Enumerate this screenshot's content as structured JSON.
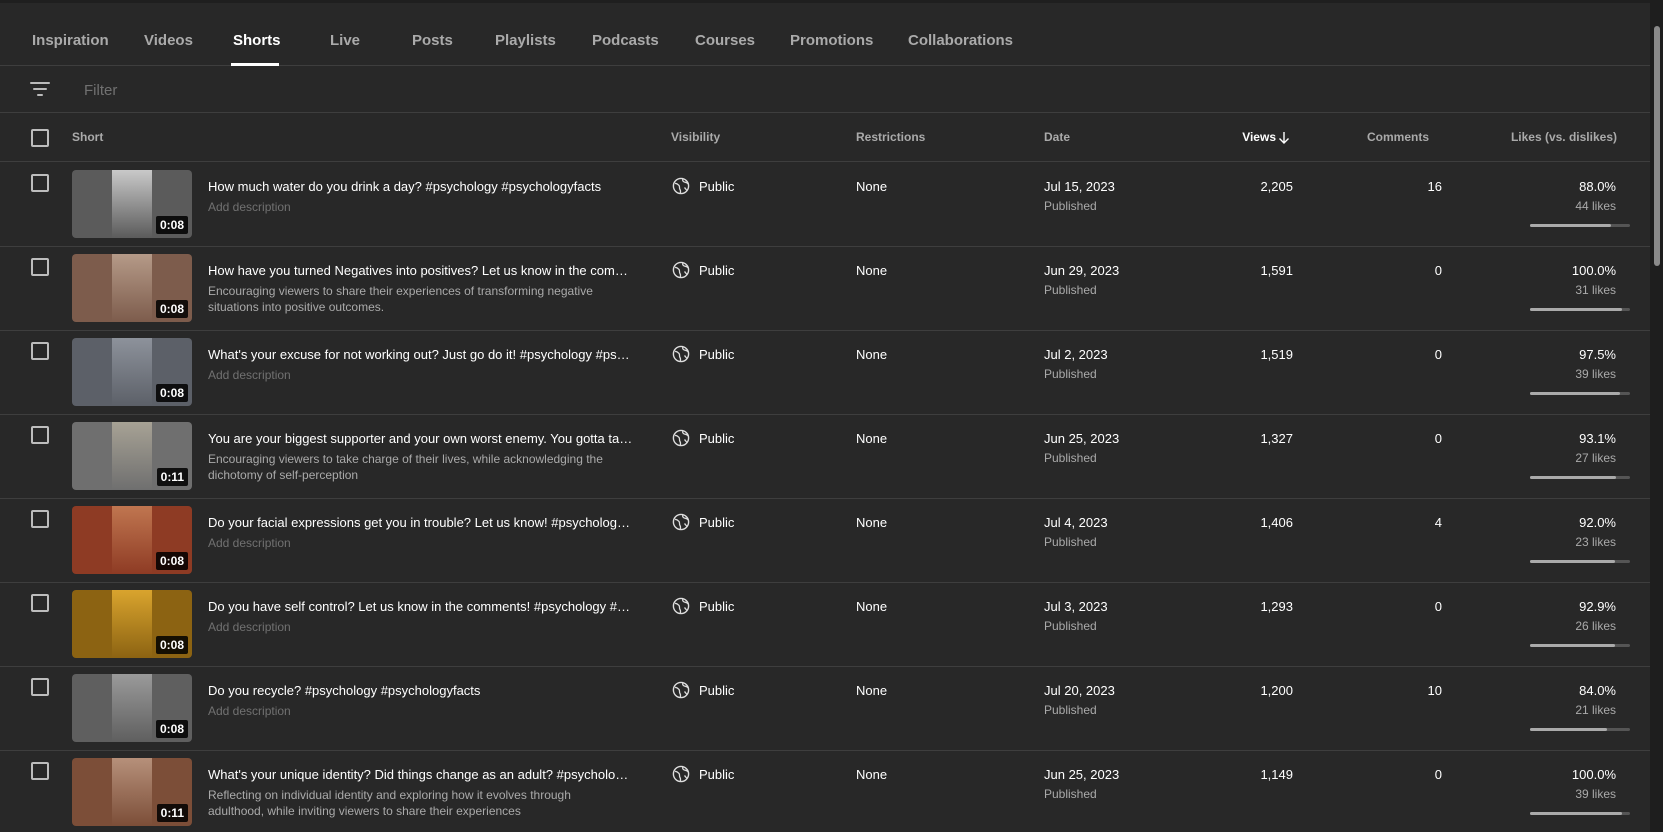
{
  "tabs": [
    {
      "label": "Inspiration"
    },
    {
      "label": "Videos"
    },
    {
      "label": "Shorts",
      "active": true
    },
    {
      "label": "Live"
    },
    {
      "label": "Posts"
    },
    {
      "label": "Playlists"
    },
    {
      "label": "Podcasts"
    },
    {
      "label": "Courses"
    },
    {
      "label": "Promotions"
    },
    {
      "label": "Collaborations"
    }
  ],
  "filter": {
    "placeholder": "Filter",
    "icon": "filter-icon"
  },
  "table": {
    "headers": {
      "short": "Short",
      "visibility": "Visibility",
      "restrictions": "Restrictions",
      "date": "Date",
      "views": "Views",
      "views_sort_icon": "arrow-down-icon",
      "comments": "Comments",
      "likes": "Likes (vs. dislikes)"
    },
    "rows": [
      {
        "duration": "0:08",
        "title": "How much water do you drink a day? #psychology #psychologyfacts",
        "description": "Add description",
        "description_is_placeholder": true,
        "visibility": "Public",
        "restrictions": "None",
        "date": "Jul 15, 2023",
        "status": "Published",
        "views": "2,205",
        "comments": "16",
        "likes_pct": "88.0%",
        "likes_count": "44 likes",
        "likes_ratio": 0.88,
        "thumb_colors": [
          "#5b5b5b",
          "#c9c9c9"
        ]
      },
      {
        "duration": "0:08",
        "title": "How have you turned Negatives into positives? Let us know in the comments! #psychology #psychologyfacts",
        "description": "Encouraging viewers to share their experiences of transforming negative situations into positive outcomes.",
        "description_is_placeholder": false,
        "visibility": "Public",
        "restrictions": "None",
        "date": "Jun 29, 2023",
        "status": "Published",
        "views": "1,591",
        "comments": "0",
        "likes_pct": "100.0%",
        "likes_count": "31 likes",
        "likes_ratio": 1.0,
        "thumb_colors": [
          "#7d5c4c",
          "#b59a88"
        ]
      },
      {
        "duration": "0:08",
        "title": "What's your excuse for not working out? Just go do it! #psychology #psychologyfacts",
        "description": "Add description",
        "description_is_placeholder": true,
        "visibility": "Public",
        "restrictions": "None",
        "date": "Jul 2, 2023",
        "status": "Published",
        "views": "1,519",
        "comments": "0",
        "likes_pct": "97.5%",
        "likes_count": "39 likes",
        "likes_ratio": 0.975,
        "thumb_colors": [
          "#5c6068",
          "#8d929b"
        ]
      },
      {
        "duration": "0:11",
        "title": "You are your biggest supporter and your own worst enemy. You gotta take charge #psychology #psychologyfacts",
        "description": "Encouraging viewers to take charge of their lives, while acknowledging the dichotomy of self-perception",
        "description_is_placeholder": false,
        "visibility": "Public",
        "restrictions": "None",
        "date": "Jun 25, 2023",
        "status": "Published",
        "views": "1,327",
        "comments": "0",
        "likes_pct": "93.1%",
        "likes_count": "27 likes",
        "likes_ratio": 0.931,
        "thumb_colors": [
          "#6f6f6f",
          "#a7a295"
        ]
      },
      {
        "duration": "0:08",
        "title": "Do your facial expressions get you in trouble? Let us know! #psychology #psychologyfacts",
        "description": "Add description",
        "description_is_placeholder": true,
        "visibility": "Public",
        "restrictions": "None",
        "date": "Jul 4, 2023",
        "status": "Published",
        "views": "1,406",
        "comments": "4",
        "likes_pct": "92.0%",
        "likes_count": "23 likes",
        "likes_ratio": 0.92,
        "thumb_colors": [
          "#8e3b24",
          "#c07650"
        ]
      },
      {
        "duration": "0:08",
        "title": "Do you have self control? Let us know in the comments! #psychology #psychologyfacts",
        "description": "Add description",
        "description_is_placeholder": true,
        "visibility": "Public",
        "restrictions": "None",
        "date": "Jul 3, 2023",
        "status": "Published",
        "views": "1,293",
        "comments": "0",
        "likes_pct": "92.9%",
        "likes_count": "26 likes",
        "likes_ratio": 0.929,
        "thumb_colors": [
          "#8c6312",
          "#d9a42e"
        ]
      },
      {
        "duration": "0:08",
        "title": "Do you recycle? #psychology #psychologyfacts",
        "description": "Add description",
        "description_is_placeholder": true,
        "visibility": "Public",
        "restrictions": "None",
        "date": "Jul 20, 2023",
        "status": "Published",
        "views": "1,200",
        "comments": "10",
        "likes_pct": "84.0%",
        "likes_count": "21 likes",
        "likes_ratio": 0.84,
        "thumb_colors": [
          "#5f5f5f",
          "#9a9a9a"
        ]
      },
      {
        "duration": "0:11",
        "title": "What's your unique identity? Did things change as an adult? #psychology #psychologyfacts",
        "description": "Reflecting on individual identity and exploring how it evolves through adulthood, while inviting viewers to share their experiences",
        "description_is_placeholder": false,
        "visibility": "Public",
        "restrictions": "None",
        "date": "Jun 25, 2023",
        "status": "Published",
        "views": "1,149",
        "comments": "0",
        "likes_pct": "100.0%",
        "likes_count": "39 likes",
        "likes_ratio": 1.0,
        "thumb_colors": [
          "#7c4e38",
          "#b6907a"
        ]
      }
    ]
  }
}
